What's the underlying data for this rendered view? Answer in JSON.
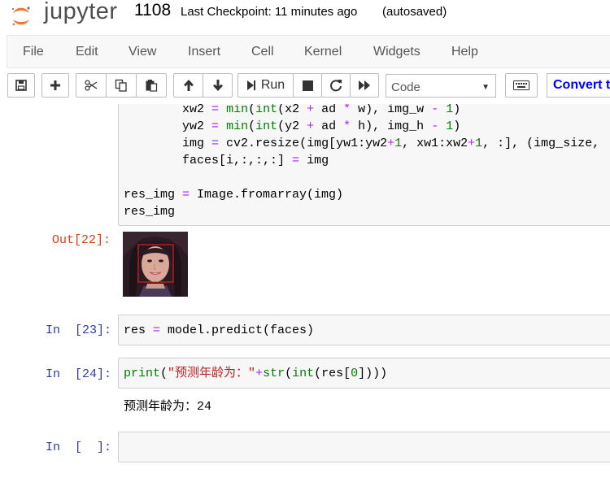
{
  "header": {
    "logo_text": "jupyter",
    "notebook_name": "1108",
    "checkpoint": "Last Checkpoint: 11 minutes ago",
    "autosave_status": "(autosaved)"
  },
  "menu": {
    "items": [
      "File",
      "Edit",
      "View",
      "Insert",
      "Cell",
      "Kernel",
      "Widgets",
      "Help"
    ]
  },
  "toolbar": {
    "run_label": "Run",
    "cell_type": "Code",
    "convert_label": "Convert t"
  },
  "cells": {
    "c22": {
      "lines": [
        [
          "        ",
          "xw2 ",
          "=",
          " ",
          "min",
          "(",
          "int",
          "(x2 ",
          "+",
          " ad ",
          "*",
          " w), img_w ",
          "-",
          " ",
          "1",
          ")"
        ],
        [
          "        ",
          "yw2 ",
          "=",
          " ",
          "min",
          "(",
          "int",
          "(y2 ",
          "+",
          " ad ",
          "*",
          " h), img_h ",
          "-",
          " ",
          "1",
          ")"
        ],
        [
          "        ",
          "img ",
          "=",
          " cv2.resize(img[yw1:yw2",
          "+",
          "1",
          ", xw1:xw2",
          "+",
          "1",
          ", :], (img_size,"
        ],
        [
          "        ",
          "faces[i,:,:,:] ",
          "=",
          " img"
        ],
        [
          ""
        ],
        [
          "res_img ",
          "=",
          " Image.fromarray(img)"
        ],
        [
          "res_img"
        ]
      ],
      "out_prompt": "Out[22]:"
    },
    "c23": {
      "prompt": "In  [23]:",
      "code": "res = model.predict(faces)"
    },
    "c24": {
      "prompt": "In  [24]:",
      "code_func": "print",
      "code_open": "(",
      "code_str": "\"预测年龄为：\"",
      "code_plus": "+",
      "code_rest": "str(int(res[0])))",
      "output": "预测年龄为：24"
    },
    "c25": {
      "prompt": "In  [  ]:"
    }
  },
  "colors": {
    "input_bg": "#f7f7f7",
    "in_prompt": "#303f9f",
    "out_prompt": "#d84315",
    "keyword": "#008000",
    "operator": "#aa22ff",
    "string": "#ba2121"
  }
}
